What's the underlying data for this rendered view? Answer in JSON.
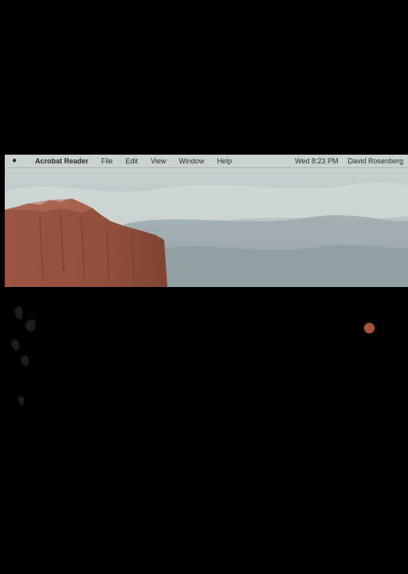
{
  "menubar": {
    "apple_icon": "apple-logo-icon",
    "app_name": "Acrobat Reader",
    "menus": [
      "File",
      "Edit",
      "View",
      "Window",
      "Help"
    ],
    "clock": "Wed 8:23 PM",
    "user": "David Rosenberg"
  },
  "colors": {
    "menubar": "#c9d2d1",
    "cliff": "#94503d",
    "sky": "#b9c5c6",
    "background": "#000000"
  }
}
